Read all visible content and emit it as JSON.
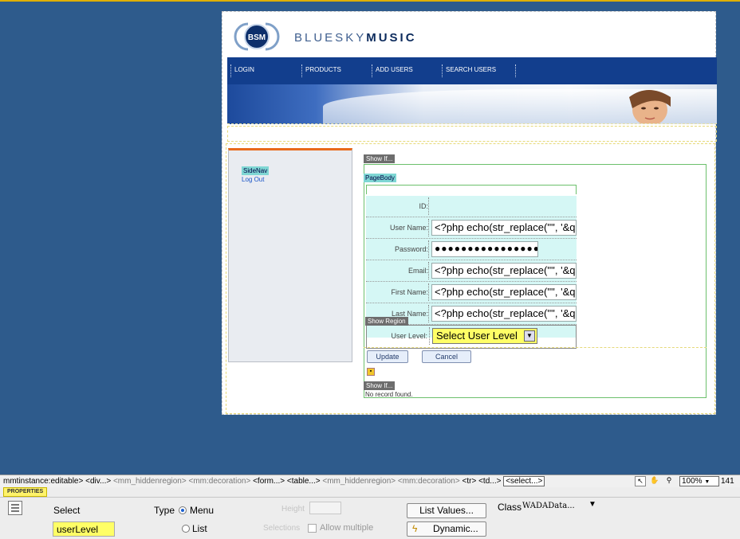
{
  "site": {
    "brand_light": "BLUESKY",
    "brand_bold": "MUSIC",
    "logo_text": "BSM",
    "nav": [
      "LOGIN",
      "PRODUCTS",
      "ADD USERS",
      "SEARCH USERS"
    ]
  },
  "sidenav": {
    "label": "SideNav",
    "logout": "Log Out"
  },
  "form": {
    "show_if_top": "Show If...",
    "page_body": "PageBody",
    "show_region": "Show Region",
    "rows": [
      {
        "label": "ID:",
        "value": ""
      },
      {
        "label": "User Name:",
        "value": "<?php echo(str_replace('\"', '&qu"
      },
      {
        "label": "Password:",
        "value": "●●●●●●●●●●●●●●●●"
      },
      {
        "label": "Email:",
        "value": "<?php echo(str_replace('\"', '&qu"
      },
      {
        "label": "First Name:",
        "value": "<?php echo(str_replace('\"', '&qu"
      },
      {
        "label": "Last Name:",
        "value": "<?php echo(str_replace('\"', '&qu"
      },
      {
        "label": "User Level:",
        "value": "Select User Level"
      }
    ],
    "update_label": "Update",
    "cancel_label": "Cancel",
    "show_if_bottom": "Show If...",
    "no_record": "No record found."
  },
  "tagbar": {
    "path_start": "mmtinstance:editable>",
    "path_div": "<div...>",
    "path_hidden1": "<mm_hiddenregion>",
    "path_deco1": "<mm:decoration>",
    "path_form": "<form...>",
    "path_table": "<table...>",
    "path_hidden2": "<mm_hiddenregion>",
    "path_deco2": "<mm:decoration>",
    "path_tr": "<tr>",
    "path_td": "<td...>",
    "path_select": "<select...>",
    "zoom": "100%",
    "size": "141"
  },
  "properties": {
    "tab": "PROPERTIES",
    "element_type": "Select",
    "name_value": "userLevel",
    "type_label": "Type",
    "menu_label": "Menu",
    "list_label": "List",
    "height_label": "Height",
    "selections_label": "Selections",
    "allow_multiple_label": "Allow multiple",
    "list_values_label": "List Values...",
    "dynamic_label": "Dynamic...",
    "class_label": "Class",
    "class_value": "WADAData..."
  },
  "colors": {
    "workspace": "#2e5b8c",
    "highlight": "#ffff66",
    "nav": "#123e8d"
  }
}
